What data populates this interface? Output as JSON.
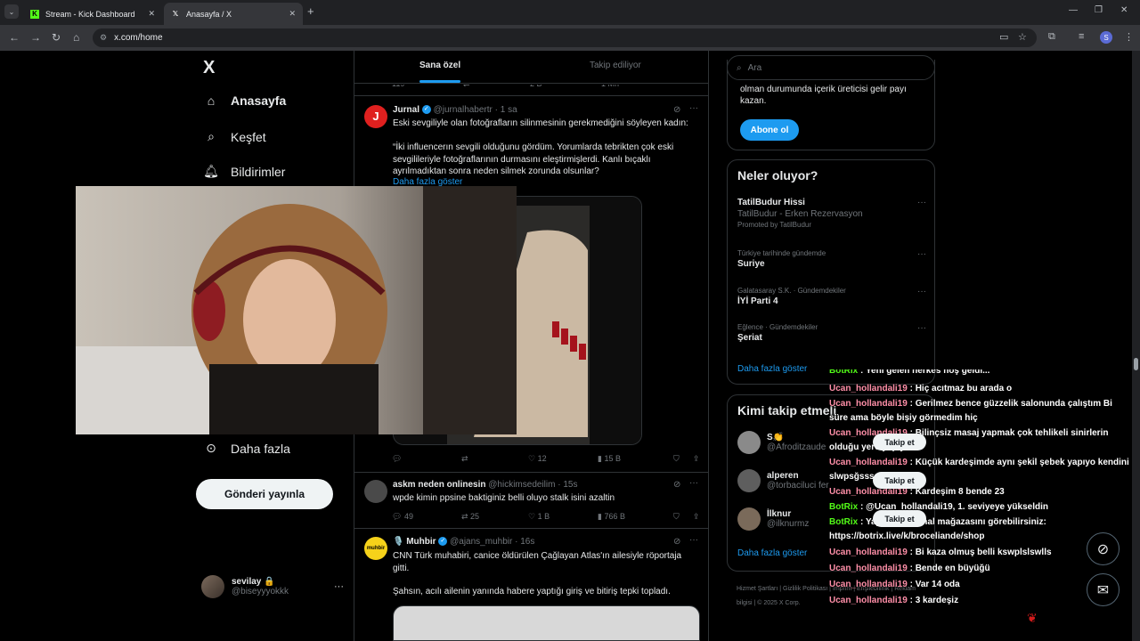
{
  "browser": {
    "tabs": [
      {
        "title": "Stream - Kick Dashboard",
        "active": false
      },
      {
        "title": "Anasayfa / X",
        "active": true
      }
    ],
    "url": "x.com/home",
    "new_tab": "+",
    "profile_initial": "S"
  },
  "nav": {
    "logo": "X",
    "items": [
      {
        "label": "Anasayfa"
      },
      {
        "label": "Keşfet"
      },
      {
        "label": "Bildirimler"
      },
      {
        "label": "Daha fazla"
      }
    ],
    "post_button": "Gönderi yayınla",
    "account": {
      "name": "sevilay 🔒",
      "handle": "@biseyyyokkk"
    }
  },
  "feed": {
    "tabs": [
      "Sana özel",
      "Takip ediliyor"
    ],
    "top_actions": {
      "replies": "119",
      "likes": "2 B",
      "views": "1 Mn"
    },
    "tweets": [
      {
        "author": "Jurnal",
        "handle": "@jurnalhabertr",
        "time": "1 sa",
        "text1": "Eski sevgiliyle olan fotoğrafların silinmesinin gerekmediğini söyleyen kadın:",
        "text2": "“İki influencerın sevgili olduğunu gördüm. Yorumlarda tebrikten çok eski sevgilileriyle fotoğraflarının durmasını eleştirmişlerdi. Kanlı bıçaklı ayrılmadıktan sonra neden silmek zorunda olsunlar?",
        "show_more": "Daha fazla göster",
        "likes": "12",
        "views": "15 B"
      },
      {
        "author": "askm neden onlinesin",
        "handle": "@hickimsedeilim",
        "time": "15s",
        "text1": "wpde kimin ppsine baktiginiz belli oluyo stalk isini azaltin",
        "replies": "49",
        "retweets": "25",
        "likes": "1 B",
        "views": "766 B"
      },
      {
        "author": "🎙️ Muhbir",
        "handle": "@ajans_muhbir",
        "time": "16s",
        "text1": "CNN Türk muhabiri, canice öldürülen Çağlayan Atlas'ın ailesiyle röportaja gitti.",
        "text2": "Şahsın, acılı ailenin yanında habere yaptığı giriş ve bitiriş tepki topladı."
      }
    ]
  },
  "sidebar": {
    "search_placeholder": "Ara",
    "premium_text": "olman durumunda içerik üreticisi gelir payı kazan.",
    "subscribe": "Abone ol",
    "trends_title": "Neler oluyor?",
    "trends": [
      {
        "context": "",
        "name": "TatilBudur Hissi",
        "sub": "TatilBudur - Erken Rezervasyon",
        "promo": "Promoted by TatilBudur"
      },
      {
        "context": "Türkiye tarihinde gündemde",
        "name": "Suriye"
      },
      {
        "context": "Galatasaray S.K. · Gündemdekiler",
        "name": "İYİ Parti 4"
      },
      {
        "context": "Eğlence · Gündemdekiler",
        "name": "Şeriat"
      }
    ],
    "show_more": "Daha fazla göster",
    "who_title": "Kimi takip etmeli",
    "who": [
      {
        "name": "S👏",
        "handle": "@Afroditzaude"
      },
      {
        "name": "alperen",
        "handle": "@torbaciluci fer"
      },
      {
        "name": "İlknur",
        "handle": "@ilknurmz"
      }
    ],
    "follow_label": "Takip et",
    "footer": "Hizmet Şartları | Gizlilik Politikası | Imprint | Erişilebilirlik | Reklam bilgisi | © 2025 X Corp."
  },
  "chat": [
    {
      "user": "BotRix",
      "text": ": Yeni gelen herkes hoş geldi...",
      "bot": true
    },
    {
      "user": "Ucan_hollandali19",
      "text": ": Hiç acıtmaz bu arada o"
    },
    {
      "user": "Ucan_hollandali19",
      "text": ": Gerilmez bence güzzelik salonunda çalıştım Bi süre ama böyle bişiy görmedim hiç"
    },
    {
      "user": "Ucan_hollandali19",
      "text": ": Bilinçsiz masaj yapmak çok tehlikeli sinirlerin olduğu yere yapıyo"
    },
    {
      "user": "Ucan_hollandali19",
      "text": ": Küçük kardeşimde aynı şekil şebek yapıyo kendini slwpsğsssss"
    },
    {
      "user": "Ucan_hollandali19",
      "text": ": Kardeşim 8 bende 23"
    },
    {
      "user": "BotRix",
      "text": ": @Ucan_hollandali19, 1. seviyeye yükseldin",
      "bot": true
    },
    {
      "user": "BotRix",
      "text": ": Yayıncının kanal mağazasını görebilirsiniz: https://botrix.live/k/broceliande/shop",
      "bot": true
    },
    {
      "user": "Ucan_hollandali19",
      "text": ": Bi kaza olmuş belli kswplslswlls"
    },
    {
      "user": "Ucan_hollandali19",
      "text": ": Bende en büyüğü"
    },
    {
      "user": "Ucan_hollandali19",
      "text": ": Var 14 oda"
    },
    {
      "user": "Ucan_hollandali19",
      "text": ": 3 kardeşiz"
    }
  ]
}
